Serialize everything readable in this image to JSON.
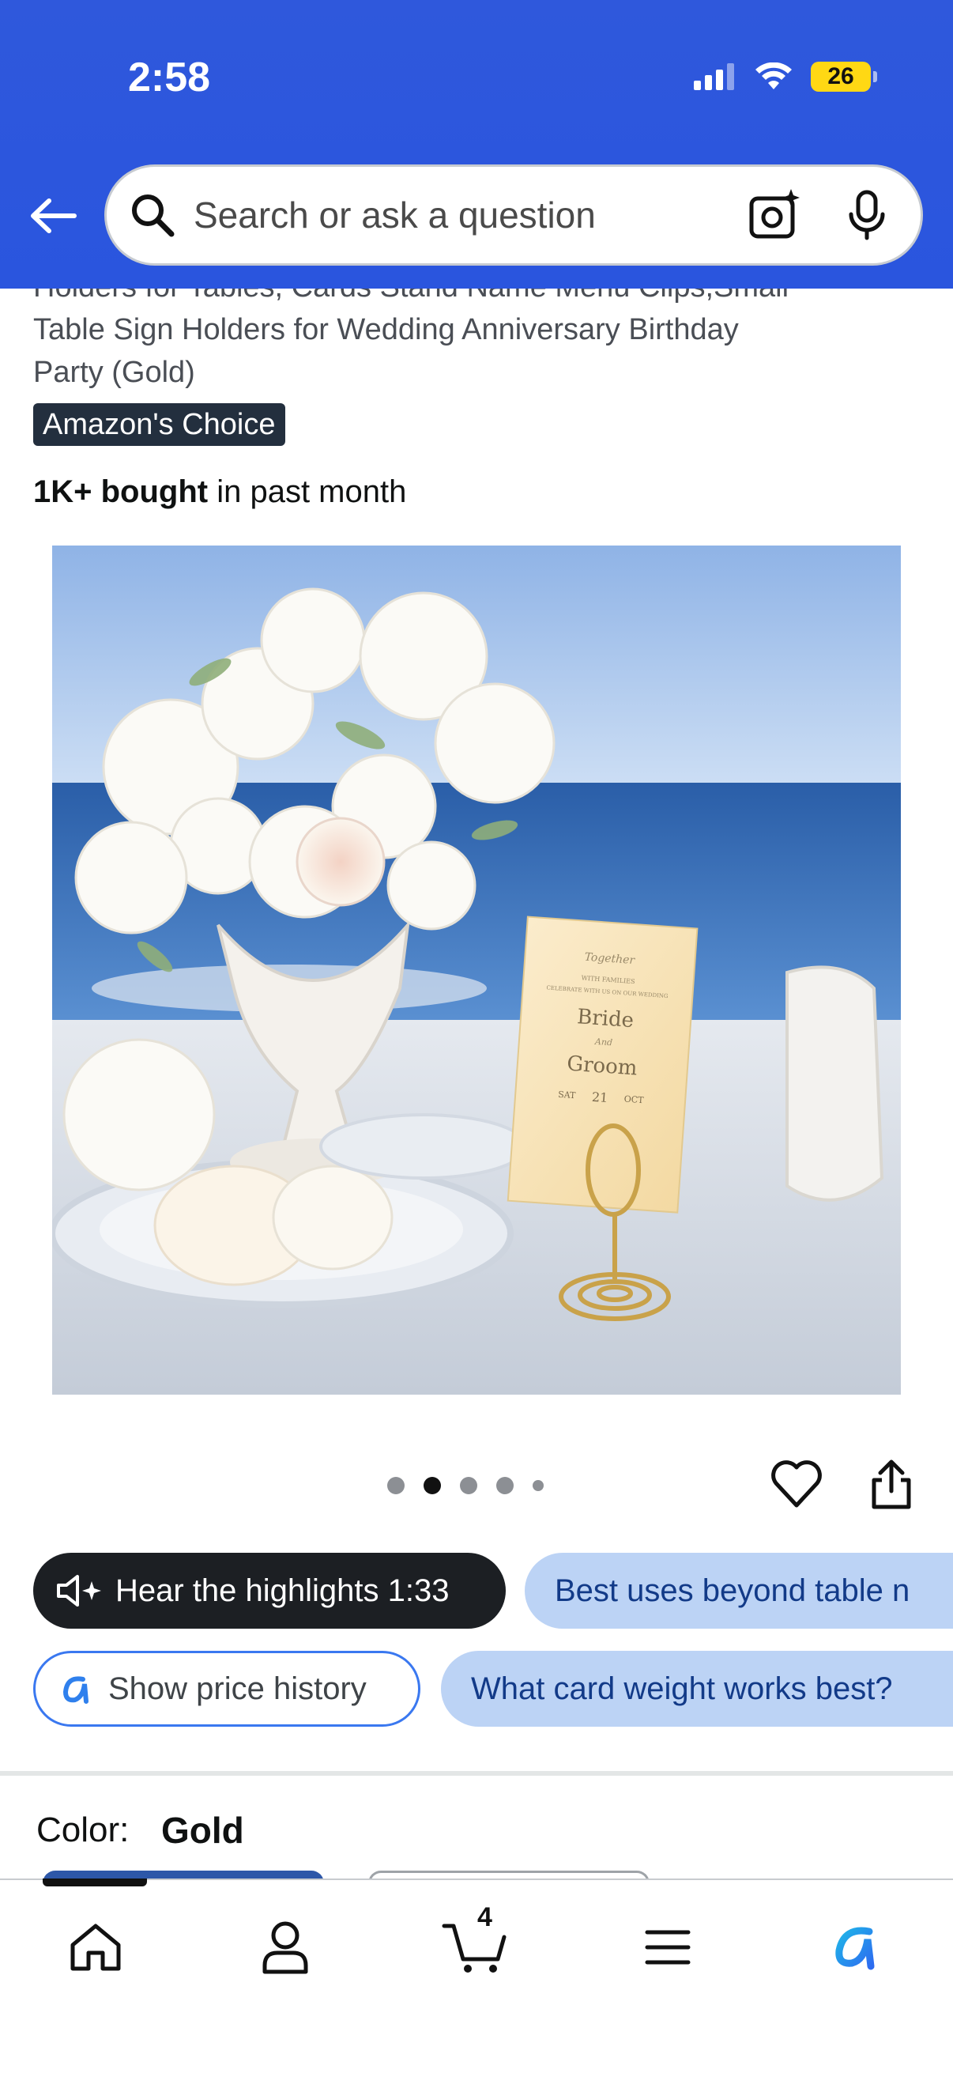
{
  "status_bar": {
    "time": "2:58",
    "battery": "26"
  },
  "search": {
    "placeholder": "Search or ask a question"
  },
  "product": {
    "title_partial_top": "Holders for Tables, Cards Stand Name Menu Clips,Small",
    "title_line2": "Table Sign Holders for Wedding Anniversary Birthday",
    "title_line3": "Party (Gold)",
    "badge": "Amazon's Choice",
    "bought_bold": "1K+ bought",
    "bought_rest": " in past month",
    "image_card": {
      "line1": "Together",
      "line2": "WITH FAMILIES",
      "line3": "CELEBRATE WITH US ON OUR WEDDING",
      "bride": "Bride",
      "and": "And",
      "groom": "Groom",
      "date_left": "SAT",
      "date_mid": "21",
      "date_right": "OCT"
    }
  },
  "carousel": {
    "count": 5,
    "active_index": 1
  },
  "chips": {
    "hear": "Hear the highlights 1:33",
    "best_uses": "Best uses beyond table n",
    "price_history": "Show price history",
    "card_weight": "What card weight works best?"
  },
  "color": {
    "label": "Color:",
    "value": "Gold"
  },
  "bottom_nav": {
    "cart_count": "4"
  },
  "colors": {
    "header_blue": "#2a55de",
    "chip_blue": "#bcd3f5",
    "chip_text": "#123a88",
    "badge": "#232f3e"
  }
}
